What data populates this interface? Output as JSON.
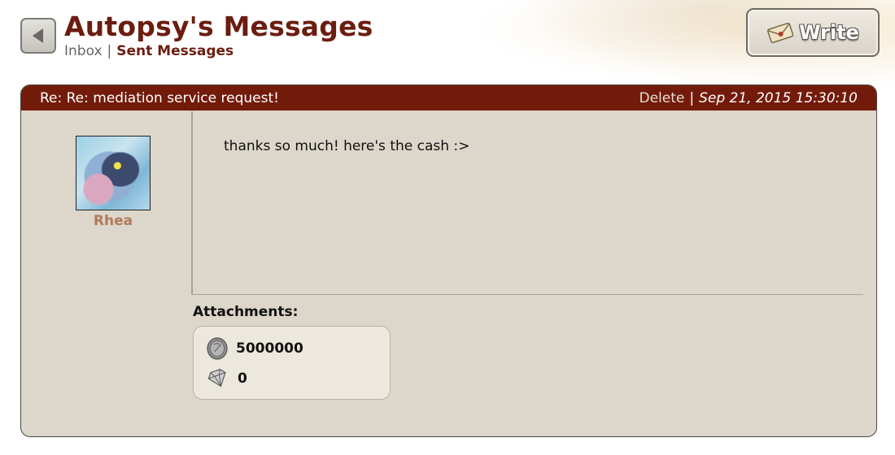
{
  "header": {
    "title": "Autopsy's Messages",
    "inbox_label": "Inbox",
    "separator": "|",
    "sent_label": "Sent Messages",
    "write_label": "Write"
  },
  "message": {
    "subject": "Re: Re: mediation service request!",
    "delete_label": "Delete",
    "separator": "|",
    "date": "Sep 21, 2015 15:30:10",
    "sender_name": "Rhea",
    "body": "thanks so much! here's the cash :>"
  },
  "attachments": {
    "title": "Attachments:",
    "treasure": "5000000",
    "gems": "0"
  },
  "colors": {
    "title": "#6b1d10",
    "header_bar": "#731b0b",
    "panel_bg": "#dcd6cb",
    "attachment_bg": "#ece8dd",
    "sender_name": "#b07a58"
  },
  "icons": {
    "back": "back-arrow-icon",
    "write": "envelope-icon",
    "treasure": "coin-icon",
    "gems": "gem-icon"
  }
}
